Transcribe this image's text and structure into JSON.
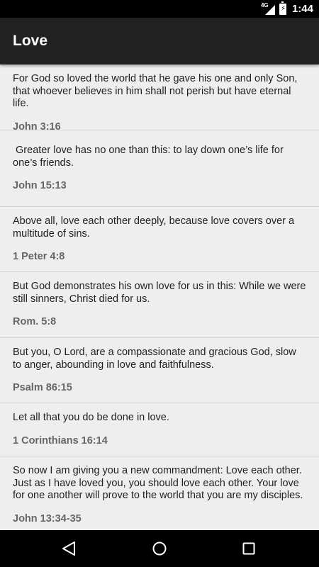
{
  "status_bar": {
    "network_type": "4G",
    "time": "1:44"
  },
  "app_bar": {
    "title": "Love"
  },
  "verses": [
    {
      "text": "For God so loved the world that he gave his one and only Son, that whoever believes in him shall not perish but have eternal life.",
      "reference": "John 3:16"
    },
    {
      "text": " Greater love has no one than this: to lay down one’s life for one’s friends.",
      "reference": "John 15:13"
    },
    {
      "text": "Above all, love each other deeply, because love covers over a multitude of sins.",
      "reference": "1 Peter 4:8"
    },
    {
      "text": "But God demonstrates his own love for us in this: While we were still sinners, Christ died for us.",
      "reference": "Rom. 5:8"
    },
    {
      "text": "But you, O Lord, are a compassionate and gracious God, slow to anger, abounding in love and faithfulness.",
      "reference": "Psalm 86:15"
    },
    {
      "text": "Let all that you do be done in love.",
      "reference": "1 Corinthians 16:14"
    },
    {
      "text": "So now I am giving you a new commandment: Love each other.  Just as I have loved you, you should love each other. Your love for one another will prove to the world that you are my disciples.",
      "reference": "John 13:34-35"
    }
  ],
  "nav_bar": {
    "icons": [
      "back-icon",
      "home-icon",
      "recents-icon"
    ]
  },
  "colors": {
    "app_bar": "#212121",
    "background": "#eeeeee",
    "reference_text": "#666666"
  }
}
